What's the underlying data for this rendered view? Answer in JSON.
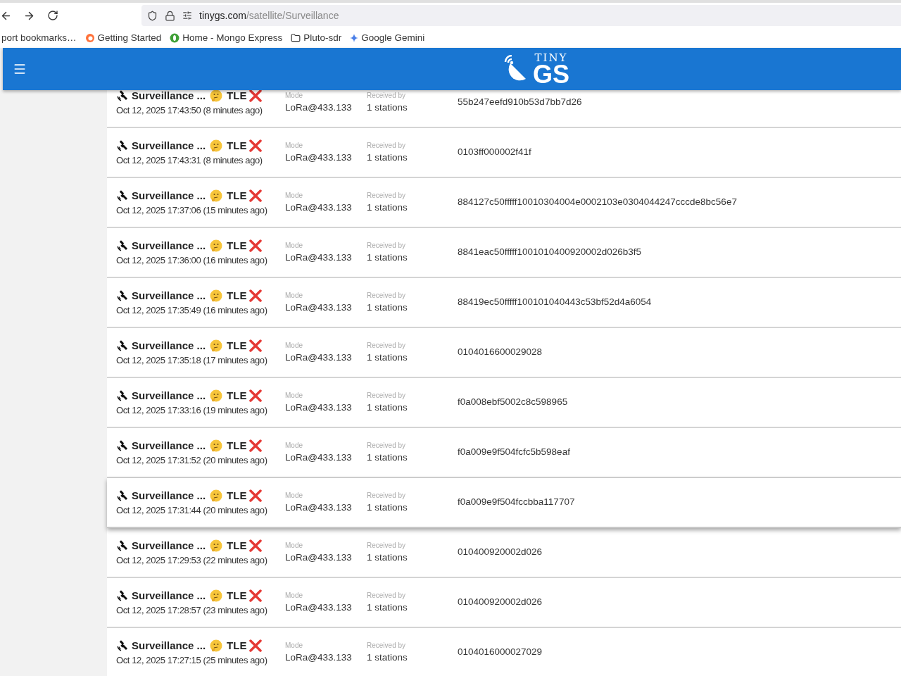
{
  "browser": {
    "url_host": "tinygs.com",
    "url_path": "/satellite/Surveillance",
    "bookmarks": [
      {
        "label": "port bookmarks…",
        "kind": "plain"
      },
      {
        "label": "Getting Started",
        "kind": "firefox"
      },
      {
        "label": "Home - Mongo Express",
        "kind": "leaf"
      },
      {
        "label": "Pluto-sdr",
        "kind": "folder"
      },
      {
        "label": "Google Gemini",
        "kind": "sparkle"
      }
    ]
  },
  "app_bar": {
    "logo_top": "TINY",
    "logo_main": "GS"
  },
  "packets": [
    {
      "title": "Surveillance ...",
      "tag": "TLE",
      "date": "Oct 12, 2025 17:43:50 (8 minutes ago)",
      "mode_label": "Mode",
      "mode": "LoRa@433.133",
      "received_label": "Received by",
      "received": "1 stations",
      "data": "55b247eefd910b53d7bb7d26",
      "raised": false
    },
    {
      "title": "Surveillance ...",
      "tag": "TLE",
      "date": "Oct 12, 2025 17:43:31 (8 minutes ago)",
      "mode_label": "Mode",
      "mode": "LoRa@433.133",
      "received_label": "Received by",
      "received": "1 stations",
      "data": "0103ff000002f41f",
      "raised": false
    },
    {
      "title": "Surveillance ...",
      "tag": "TLE",
      "date": "Oct 12, 2025 17:37:06 (15 minutes ago)",
      "mode_label": "Mode",
      "mode": "LoRa@433.133",
      "received_label": "Received by",
      "received": "1 stations",
      "data": "884127c50fffff10010304004e0002103e0304044247cccde8bc56e7",
      "raised": false
    },
    {
      "title": "Surveillance ...",
      "tag": "TLE",
      "date": "Oct 12, 2025 17:36:00 (16 minutes ago)",
      "mode_label": "Mode",
      "mode": "LoRa@433.133",
      "received_label": "Received by",
      "received": "1 stations",
      "data": "8841eac50fffff1001010400920002d026b3f5",
      "raised": false
    },
    {
      "title": "Surveillance ...",
      "tag": "TLE",
      "date": "Oct 12, 2025 17:35:49 (16 minutes ago)",
      "mode_label": "Mode",
      "mode": "LoRa@433.133",
      "received_label": "Received by",
      "received": "1 stations",
      "data": "88419ec50fffff100101040443c53bf52d4a6054",
      "raised": false
    },
    {
      "title": "Surveillance ...",
      "tag": "TLE",
      "date": "Oct 12, 2025 17:35:18 (17 minutes ago)",
      "mode_label": "Mode",
      "mode": "LoRa@433.133",
      "received_label": "Received by",
      "received": "1 stations",
      "data": "0104016600029028",
      "raised": false
    },
    {
      "title": "Surveillance ...",
      "tag": "TLE",
      "date": "Oct 12, 2025 17:33:16 (19 minutes ago)",
      "mode_label": "Mode",
      "mode": "LoRa@433.133",
      "received_label": "Received by",
      "received": "1 stations",
      "data": "f0a008ebf5002c8c598965",
      "raised": false
    },
    {
      "title": "Surveillance ...",
      "tag": "TLE",
      "date": "Oct 12, 2025 17:31:52 (20 minutes ago)",
      "mode_label": "Mode",
      "mode": "LoRa@433.133",
      "received_label": "Received by",
      "received": "1 stations",
      "data": "f0a009e9f504fcfc5b598eaf",
      "raised": false
    },
    {
      "title": "Surveillance ...",
      "tag": "TLE",
      "date": "Oct 12, 2025 17:31:44 (20 minutes ago)",
      "mode_label": "Mode",
      "mode": "LoRa@433.133",
      "received_label": "Received by",
      "received": "1 stations",
      "data": "f0a009e9f504fccbba117707",
      "raised": true
    },
    {
      "title": "Surveillance ...",
      "tag": "TLE",
      "date": "Oct 12, 2025 17:29:53 (22 minutes ago)",
      "mode_label": "Mode",
      "mode": "LoRa@433.133",
      "received_label": "Received by",
      "received": "1 stations",
      "data": "010400920002d026",
      "raised": false
    },
    {
      "title": "Surveillance ...",
      "tag": "TLE",
      "date": "Oct 12, 2025 17:28:57 (23 minutes ago)",
      "mode_label": "Mode",
      "mode": "LoRa@433.133",
      "received_label": "Received by",
      "received": "1 stations",
      "data": "010400920002d026",
      "raised": false
    },
    {
      "title": "Surveillance ...",
      "tag": "TLE",
      "date": "Oct 12, 2025 17:27:15 (25 minutes ago)",
      "mode_label": "Mode",
      "mode": "LoRa@433.133",
      "received_label": "Received by",
      "received": "1 stations",
      "data": "0104016000027029",
      "raised": false
    }
  ]
}
